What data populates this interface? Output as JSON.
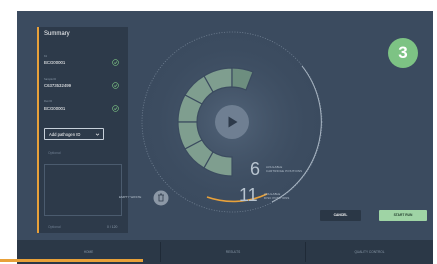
{
  "badge": {
    "number": "3",
    "color": "#7dc384"
  },
  "summary": {
    "title": "Summary",
    "fields": [
      {
        "label": "Kit",
        "value": "BCG00001"
      },
      {
        "label": "Sample ID",
        "value": "C6373532499"
      },
      {
        "label": "Run ID",
        "value": "BCG00001"
      }
    ],
    "pathogen_select": {
      "label": "Add pathogen ID",
      "icon": "chevron-down-icon"
    },
    "optional_placeholder": "Optional",
    "notes_placeholder": "Optional",
    "notes_counter": "0 / 120"
  },
  "dial": {
    "cartridge_count": "6",
    "cartridge_label_line1": "AVAILABLE",
    "cartridge_label_line2": "CARTRIDGE POSITIONS",
    "disc_count": "11",
    "disc_label_line1": "AVAILABLE",
    "disc_label_line2": "DISC POSITIONS",
    "empty_waste_label": "EMPTY WASTE",
    "play_icon": "play-icon",
    "trash_icon": "trash-icon",
    "accent": "#e8a13a",
    "segment_color": "#7f9e8f"
  },
  "actions": {
    "cancel": "CANCEL",
    "start": "START RUN"
  },
  "nav": {
    "tabs": [
      "HOME",
      "RESULTS",
      "QUALITY CONTROL"
    ],
    "active": "HOME"
  }
}
